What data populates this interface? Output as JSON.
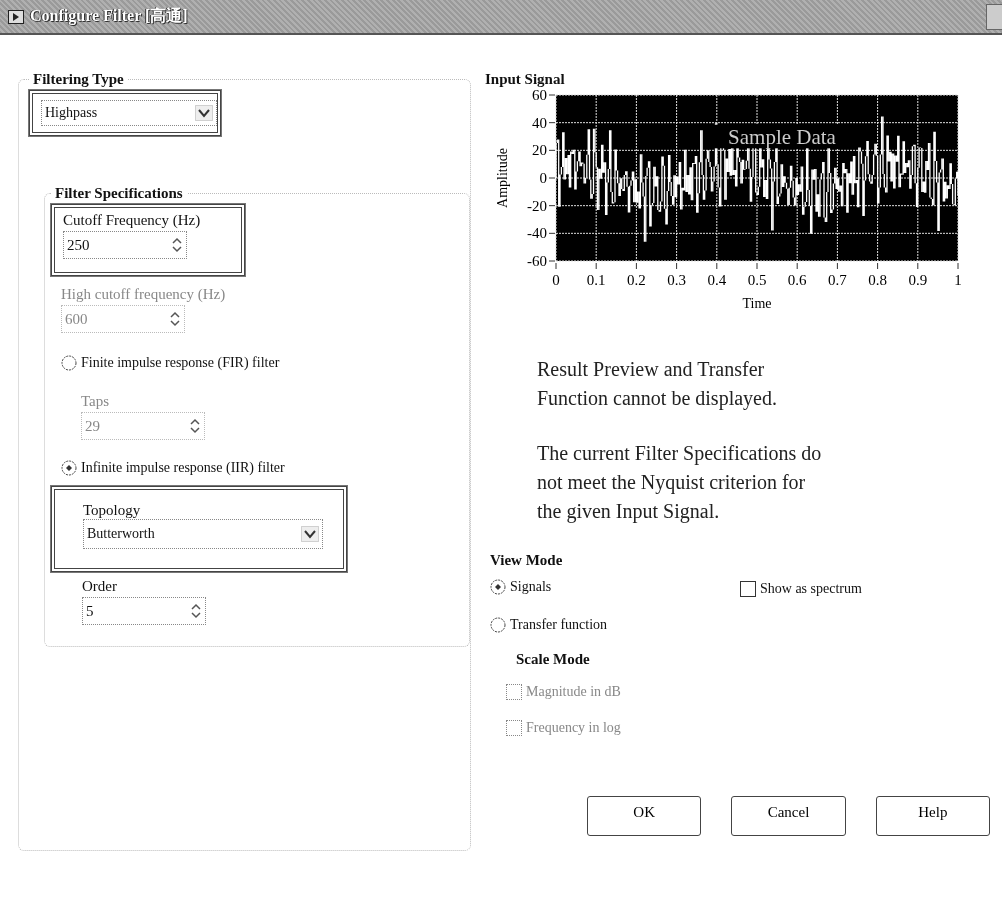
{
  "window": {
    "title": "Configure Filter [高通]"
  },
  "filtering_type": {
    "title": "Filtering Type",
    "value": "Highpass"
  },
  "filter_specifications": {
    "title": "Filter Specifications",
    "cutoff": {
      "label": "Cutoff Frequency (Hz)",
      "value": "250"
    },
    "high_cutoff": {
      "label": "High cutoff frequency (Hz)",
      "value": "600",
      "disabled": true
    },
    "fir": {
      "label": "Finite impulse response (FIR) filter",
      "selected": false
    },
    "taps": {
      "label": "Taps",
      "value": "29",
      "disabled": true
    },
    "iir": {
      "label": "Infinite impulse response (IIR) filter",
      "selected": true
    },
    "topology": {
      "label": "Topology",
      "value": "Butterworth"
    },
    "order": {
      "label": "Order",
      "value": "5"
    }
  },
  "input_signal": {
    "title": "Input Signal",
    "ylabel": "Amplitude",
    "xlabel": "Time",
    "overlay": "Sample Data",
    "yticks": [
      "60",
      "40",
      "20",
      "0",
      "-20",
      "-40",
      "-60"
    ],
    "xticks": [
      "0",
      "0.1",
      "0.2",
      "0.3",
      "0.4",
      "0.5",
      "0.6",
      "0.7",
      "0.8",
      "0.9",
      "1"
    ]
  },
  "message": [
    "Result Preview and Transfer Function cannot be displayed.",
    "The current Filter Specifications do not meet the Nyquist criterion for the given Input Signal."
  ],
  "view_mode": {
    "title": "View Mode",
    "options": [
      {
        "label": "Signals",
        "selected": true
      },
      {
        "label": "Transfer function",
        "selected": false
      }
    ],
    "show_as_spectrum": {
      "label": "Show as spectrum",
      "checked": false
    }
  },
  "scale_mode": {
    "title": "Scale Mode",
    "options": [
      {
        "label": "Magnitude in dB",
        "checked": false,
        "disabled": true
      },
      {
        "label": "Frequency in log",
        "checked": false,
        "disabled": true
      }
    ]
  },
  "buttons": [
    "OK",
    "Cancel",
    "Help"
  ]
}
